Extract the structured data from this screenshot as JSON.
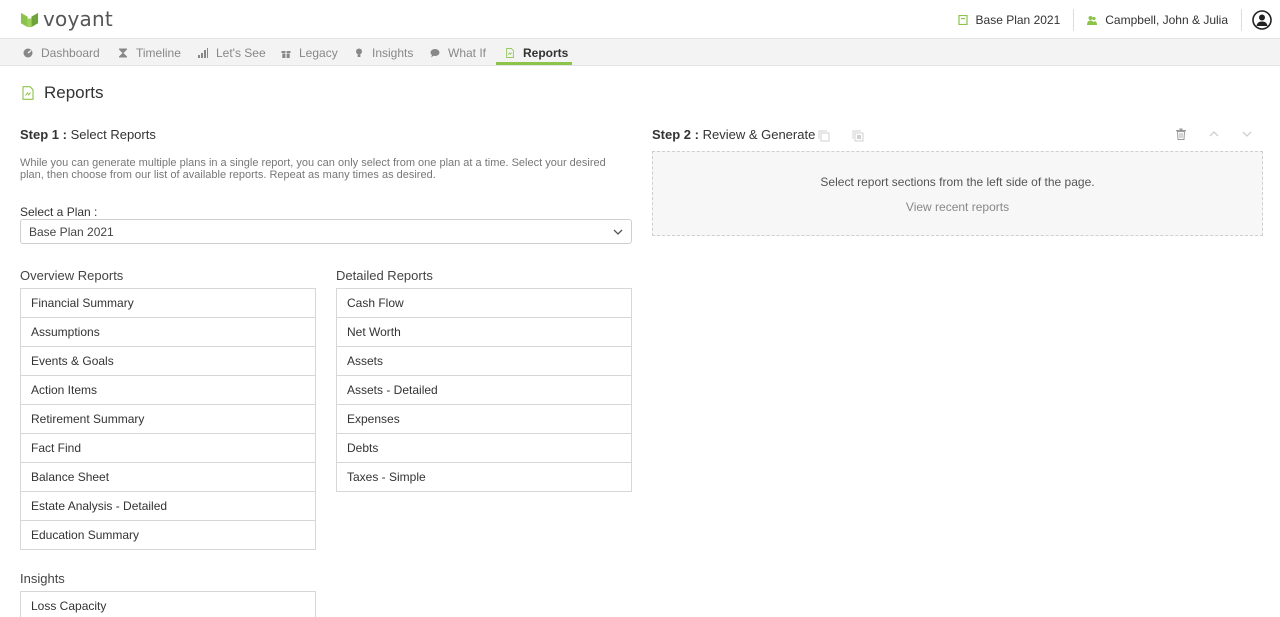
{
  "app": {
    "logo_text": "voyant"
  },
  "top_right": {
    "plan_name": "Base Plan 2021",
    "client_name": "Campbell, John & Julia"
  },
  "nav": {
    "tabs": [
      {
        "label": "Dashboard",
        "icon": "dashboard-icon"
      },
      {
        "label": "Timeline",
        "icon": "hourglass-icon"
      },
      {
        "label": "Let's See",
        "icon": "bar-chart-icon"
      },
      {
        "label": "Legacy",
        "icon": "gift-icon"
      },
      {
        "label": "Insights",
        "icon": "lightbulb-icon"
      },
      {
        "label": "What If",
        "icon": "chat-icon"
      },
      {
        "label": "Reports",
        "icon": "report-icon",
        "active": true
      }
    ]
  },
  "page": {
    "title": "Reports"
  },
  "step1": {
    "prefix": "Step 1 :",
    "title": "Select Reports",
    "instructions": "While you can generate multiple plans in a single report, you can only select from one plan at a time. Select your desired plan, then choose from our list of available reports. Repeat as many times as desired.",
    "select_label": "Select a Plan :",
    "selected_plan": "Base Plan 2021"
  },
  "overview": {
    "heading": "Overview Reports",
    "items": [
      "Financial Summary",
      "Assumptions",
      "Events & Goals",
      "Action Items",
      "Retirement Summary",
      "Fact Find",
      "Balance Sheet",
      "Estate Analysis - Detailed",
      "Education Summary"
    ]
  },
  "detailed": {
    "heading": "Detailed Reports",
    "items": [
      "Cash Flow",
      "Net Worth",
      "Assets",
      "Assets - Detailed",
      "Expenses",
      "Debts",
      "Taxes - Simple"
    ]
  },
  "insights": {
    "heading": "Insights",
    "items": [
      "Loss Capacity"
    ]
  },
  "step2": {
    "prefix": "Step 2 :",
    "title": "Review & Generate",
    "empty_message": "Select report sections from the left side of the page.",
    "recent_link": "View recent reports"
  },
  "colors": {
    "accent": "#8cc34a",
    "border": "#d6d6d6"
  }
}
